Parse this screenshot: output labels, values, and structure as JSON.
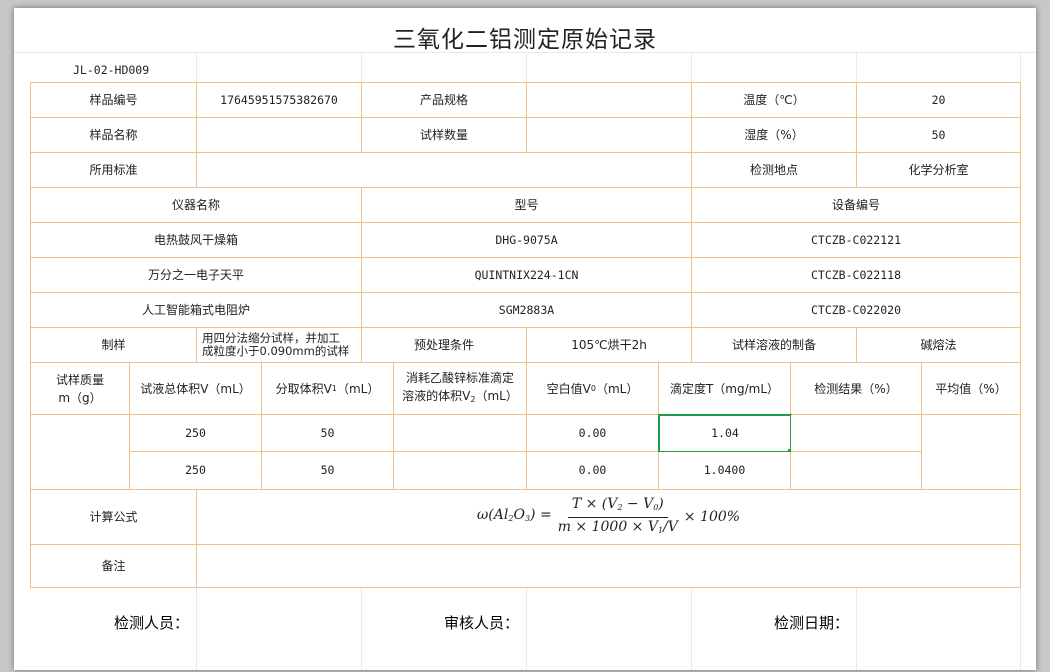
{
  "title": "三氧化二铝测定原始记录",
  "record_code": "JL-02-HD009",
  "info": {
    "sample_no_label": "样品编号",
    "sample_no_value": "17645951575382670",
    "spec_label": "产品规格",
    "spec_value": "",
    "temp_label": "温度（℃）",
    "temp_value": "20",
    "sample_name_label": "样品名称",
    "sample_name_value": "",
    "qty_label": "试样数量",
    "qty_value": "",
    "humidity_label": "湿度（%）",
    "humidity_value": "50",
    "standard_label": "所用标准",
    "standard_value": "",
    "location_label": "检测地点",
    "location_value": "化学分析室"
  },
  "instruments": {
    "col_name": "仪器名称",
    "col_model": "型号",
    "col_id": "设备编号",
    "rows": [
      {
        "name": "电热鼓风干燥箱",
        "model": "DHG-9075A",
        "id": "CTCZB-C022121"
      },
      {
        "name": "万分之一电子天平",
        "model": "QUINTNIX224-1CN",
        "id": "CTCZB-C022118"
      },
      {
        "name": "人工智能箱式电阻炉",
        "model": "SGM2883A",
        "id": "CTCZB-C022020"
      }
    ]
  },
  "prep": {
    "label": "制样",
    "value_line1": "用四分法缩分试样，并加工",
    "value_line2": "成粒度小于0.090mm的试样",
    "pretreat_label": "预处理条件",
    "pretreat_value": "105℃烘干2h",
    "solution_label": "试样溶液的制备",
    "solution_value": "碱熔法"
  },
  "measure": {
    "h_mass_1": "试样质量",
    "h_mass_2": "m（g）",
    "h_total": "试液总体积V（mL）",
    "h_aliquot": "分取体积V",
    "h_aliquot_sub": "1",
    "h_aliquot_unit": "（mL）",
    "h_titrant_1": "消耗乙酸锌标准滴定",
    "h_titrant_2": "溶液的体积V",
    "h_titrant_sub": "2",
    "h_titrant_unit": "（mL）",
    "h_blank": "空白值V",
    "h_blank_sub": "0",
    "h_blank_unit": "（mL）",
    "h_titer": "滴定度T（mg/mL）",
    "h_result": "检测结果（%）",
    "h_avg": "平均值（%）",
    "rows": [
      {
        "mass": "",
        "total": "250",
        "aliquot": "50",
        "titrant": "",
        "blank": "0.00",
        "titer": "1.04",
        "result": ""
      },
      {
        "mass": "",
        "total": "250",
        "aliquot": "50",
        "titrant": "",
        "blank": "0.00",
        "titer": "1.0400",
        "result": ""
      }
    ],
    "average": ""
  },
  "formula": {
    "label": "计算公式",
    "lhs": "ω(Al",
    "lhs_sub1": "2",
    "lhs_mid": "O",
    "lhs_sub2": "3",
    "lhs_end": ") =",
    "numerator": "T × (V",
    "num_sub_a": "2",
    "num_mid": " − V",
    "num_sub_b": "0",
    "num_end": ")",
    "denominator": "m × 1000 × V",
    "den_sub": "1",
    "den_end": "/V",
    "tail": "× 100%"
  },
  "remark_label": "备注",
  "footer": {
    "tester": "检测人员：",
    "reviewer": "审核人员：",
    "date": "检测日期："
  },
  "colors": {
    "border": "#f0c08a",
    "selection": "#1e9e4a",
    "background": "#c8c8c8"
  }
}
